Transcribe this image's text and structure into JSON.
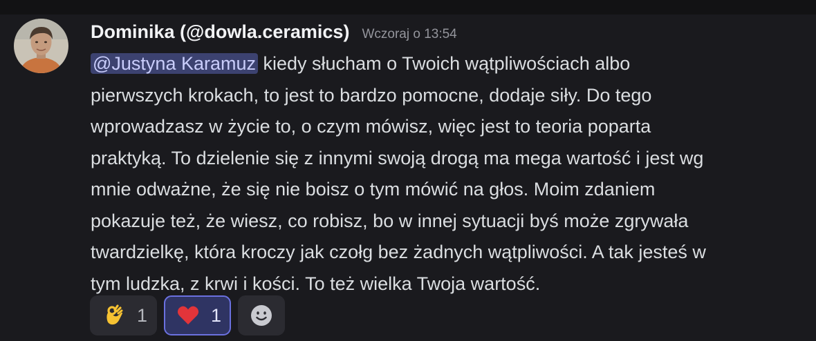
{
  "message": {
    "author": "Dominika (@dowla.ceramics)",
    "timestamp": "Wczoraj o 13:54",
    "mention": "@Justyna Karamuz",
    "lines": [
      " kiedy słucham o Twoich wątpliwościach albo",
      "pierwszych krokach, to jest to bardzo pomocne, dodaje siły. Do tego",
      "wprowadzasz w życie to, o czym mówisz, więc jest to teoria poparta",
      "praktyką. To dzielenie się z innymi swoją drogą ma mega wartość i jest wg",
      "mnie odważne, że się nie boisz o tym mówić na głos. Moim zdaniem",
      "pokazuje też, że wiesz, co robisz, bo w innej sytuacji byś może zgrywała",
      "twardzielkę, która kroczy jak czołg bez żadnych wątpliwości. A tak jesteś w",
      "tym ludzka, z krwi i kości. To też wielka Twoja wartość."
    ]
  },
  "reactions": [
    {
      "emoji": "ok-hand-icon",
      "count": "1",
      "active": false
    },
    {
      "emoji": "red-heart-icon",
      "count": "1",
      "active": true
    }
  ],
  "colors": {
    "background": "#1a1a1e",
    "mention_bg": "#3c4270",
    "mention_text": "#c9cdfb",
    "active_reaction_border": "#6b71e0"
  }
}
